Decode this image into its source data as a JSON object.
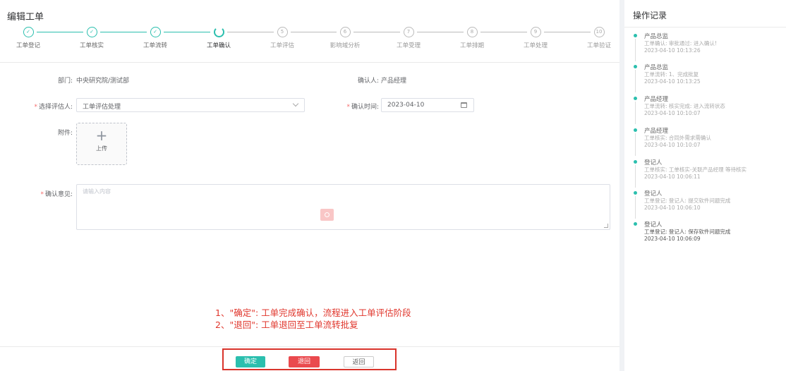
{
  "page": {
    "title": "编辑工单"
  },
  "steps": [
    {
      "num": "",
      "label": "工单登记",
      "state": "done"
    },
    {
      "num": "",
      "label": "工单核实",
      "state": "done"
    },
    {
      "num": "",
      "label": "工单流转",
      "state": "done"
    },
    {
      "num": "",
      "label": "工单确认",
      "state": "active"
    },
    {
      "num": "5",
      "label": "工单评估",
      "state": "todo"
    },
    {
      "num": "6",
      "label": "影响域分析",
      "state": "todo"
    },
    {
      "num": "7",
      "label": "工单受理",
      "state": "todo"
    },
    {
      "num": "8",
      "label": "工单排期",
      "state": "todo"
    },
    {
      "num": "9",
      "label": "工单处理",
      "state": "todo"
    },
    {
      "num": "10",
      "label": "工单验证",
      "state": "todo"
    }
  ],
  "form": {
    "dept_label": "部门:",
    "dept_value": "中央研究院/测试部",
    "confirmer_label": "确认人:",
    "confirmer_value": "产品经理",
    "assessor_label": "选择评估人:",
    "assessor_value": "工单评估处理",
    "time_label": "确认时间:",
    "time_value": "2023-04-10",
    "attach_label": "附件:",
    "upload_label": "上传",
    "opinion_label": "确认意见:",
    "opinion_placeholder": "请输入内容"
  },
  "annotation": {
    "line1": "1、\"确定\": 工单完成确认，流程进入工单评估阶段",
    "line2": "2、\"退回\": 工单退回至工单流转批复"
  },
  "buttons": {
    "confirm": "确定",
    "reject": "退回",
    "back": "返回"
  },
  "log": {
    "title": "操作记录",
    "entries": [
      {
        "who": "产品总监",
        "action": "工单确认: 审批通过: 进入确认!",
        "time": "2023-04-10 10:13:26"
      },
      {
        "who": "产品总监",
        "action": "工单流转: 1、完成批复",
        "time": "2023-04-10 10:13:25"
      },
      {
        "who": "产品经理",
        "action": "工单流转: 核实完成: 进入流转状态",
        "time": "2023-04-10 10:10:07"
      },
      {
        "who": "产品经理",
        "action": "工单核实: 合同外需求需确认",
        "time": "2023-04-10 10:10:07"
      },
      {
        "who": "登记人",
        "action": "工单核实: 工单核实-关联产品经理 等待核实",
        "time": "2023-04-10 10:06:11"
      },
      {
        "who": "登记人",
        "action": "工单登记: 登记人: 提交软件问题完成",
        "time": "2023-04-10 10:06:10"
      },
      {
        "who": "登记人",
        "action": "工单登记: 登记人: 保存软件问题完成",
        "time": "2023-04-10 10:06:09"
      }
    ]
  },
  "colors": {
    "accent": "#2bbfae",
    "danger": "#ea4a4e",
    "annotation": "#e0362c"
  }
}
